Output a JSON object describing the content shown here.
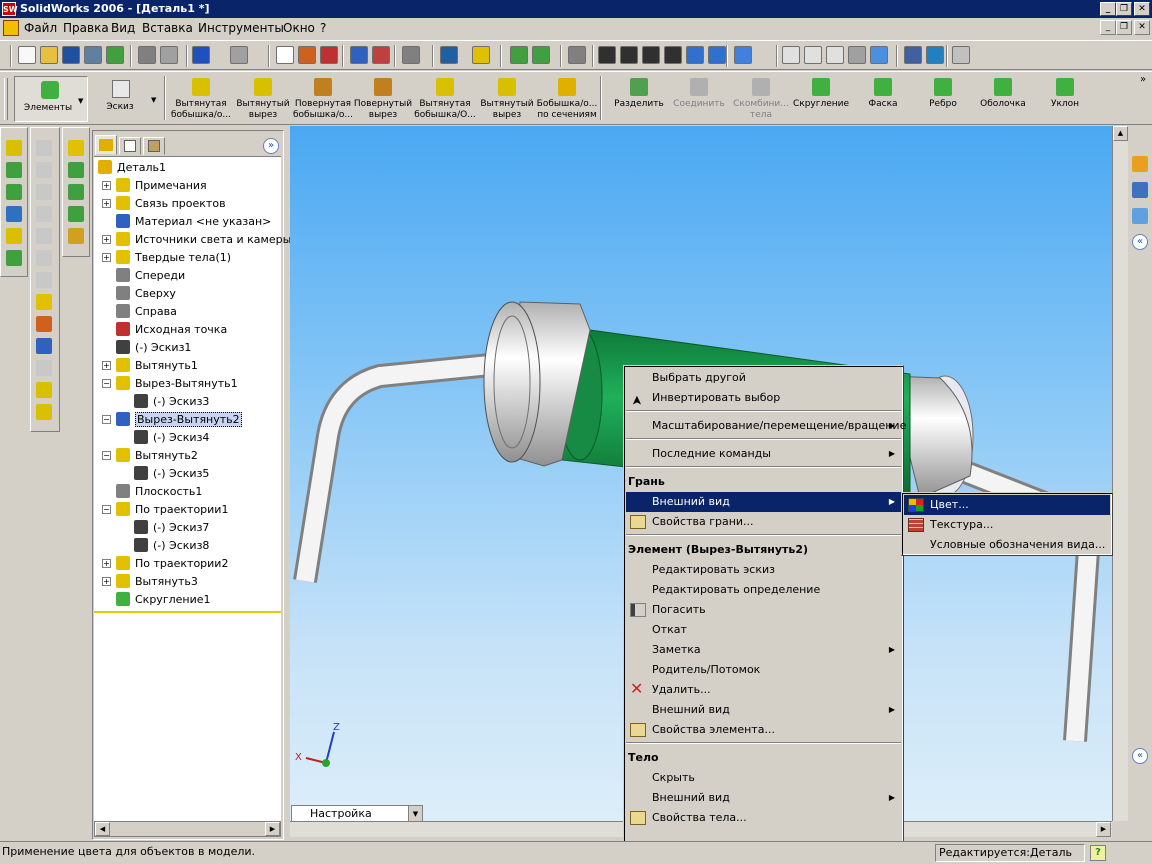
{
  "window": {
    "title": "SolidWorks 2006 - [Деталь1 *]",
    "logo_text": "SW"
  },
  "menubar": {
    "items": [
      "Файл",
      "Правка",
      "Вид",
      "Вставка",
      "Инструменты",
      "Окно",
      "?"
    ]
  },
  "features_toolbar": {
    "tabs": [
      {
        "label": "Элементы",
        "active": true
      },
      {
        "label": "Эскиз",
        "active": false
      }
    ],
    "buttons": [
      {
        "line1": "Вытянутая",
        "line2": "бобышка/о...",
        "enabled": true,
        "icon": "extrude-boss-icon",
        "color": "#d8c000"
      },
      {
        "line1": "Вытянутый",
        "line2": "вырез",
        "enabled": true,
        "icon": "extrude-cut-icon",
        "color": "#d8c000"
      },
      {
        "line1": "Повернутая",
        "line2": "бобышка/о...",
        "enabled": true,
        "icon": "revolve-boss-icon",
        "color": "#c08020"
      },
      {
        "line1": "Повернутый",
        "line2": "вырез",
        "enabled": true,
        "icon": "revolve-cut-icon",
        "color": "#c08020"
      },
      {
        "line1": "Вытянутая",
        "line2": "бобышка/О...",
        "enabled": true,
        "icon": "sweep-boss-icon",
        "color": "#d8c000"
      },
      {
        "line1": "Вытянутый",
        "line2": "вырез",
        "enabled": true,
        "icon": "sweep-cut-icon",
        "color": "#d8c000"
      },
      {
        "line1": "Бобышка/о...",
        "line2": "по сечениям",
        "enabled": true,
        "icon": "loft-icon",
        "color": "#e0b000"
      },
      {
        "line1": "Разделить",
        "line2": "",
        "enabled": true,
        "icon": "split-icon",
        "color": "#50a050"
      },
      {
        "line1": "Соединить",
        "line2": "",
        "enabled": false,
        "icon": "combine-icon",
        "color": "#b0b0b0"
      },
      {
        "line1": "Скомбини...",
        "line2": "тела",
        "enabled": false,
        "icon": "join-bodies-icon",
        "color": "#b0b0b0"
      },
      {
        "line1": "Скругление",
        "line2": "",
        "enabled": true,
        "icon": "fillet-icon",
        "color": "#40b040"
      },
      {
        "line1": "Фаска",
        "line2": "",
        "enabled": true,
        "icon": "chamfer-icon",
        "color": "#40b040"
      },
      {
        "line1": "Ребро",
        "line2": "",
        "enabled": true,
        "icon": "rib-icon",
        "color": "#40b040"
      },
      {
        "line1": "Оболочка",
        "line2": "",
        "enabled": true,
        "icon": "shell-icon",
        "color": "#40b040"
      },
      {
        "line1": "Уклон",
        "line2": "",
        "enabled": true,
        "icon": "draft-icon",
        "color": "#40b040"
      }
    ]
  },
  "feature_tree": {
    "root": "Деталь1",
    "items": [
      {
        "label": "Примечания",
        "depth": 1,
        "expander": "+",
        "icon": "annotations-icon",
        "color": "#e0c000",
        "selected": false
      },
      {
        "label": "Связь проектов",
        "depth": 1,
        "expander": "+",
        "icon": "design-binder-icon",
        "color": "#e0c000",
        "selected": false
      },
      {
        "label": "Материал <не указан>",
        "depth": 1,
        "expander": "",
        "icon": "material-icon",
        "color": "#3060c0",
        "selected": false
      },
      {
        "label": "Источники света и камеры",
        "depth": 1,
        "expander": "+",
        "icon": "lights-icon",
        "color": "#e0c000",
        "selected": false
      },
      {
        "label": "Твердые тела(1)",
        "depth": 1,
        "expander": "+",
        "icon": "solid-bodies-icon",
        "color": "#e0c000",
        "selected": false
      },
      {
        "label": "Спереди",
        "depth": 1,
        "expander": "",
        "icon": "plane-icon",
        "color": "#808080",
        "selected": false
      },
      {
        "label": "Сверху",
        "depth": 1,
        "expander": "",
        "icon": "plane-icon",
        "color": "#808080",
        "selected": false
      },
      {
        "label": "Справа",
        "depth": 1,
        "expander": "",
        "icon": "plane-icon",
        "color": "#808080",
        "selected": false
      },
      {
        "label": "Исходная точка",
        "depth": 1,
        "expander": "",
        "icon": "origin-icon",
        "color": "#c03030",
        "selected": false
      },
      {
        "label": "(-) Эскиз1",
        "depth": 1,
        "expander": "",
        "icon": "sketch-icon",
        "color": "#404040",
        "selected": false
      },
      {
        "label": "Вытянуть1",
        "depth": 1,
        "expander": "+",
        "icon": "extrude-icon",
        "color": "#e0c000",
        "selected": false
      },
      {
        "label": "Вырез-Вытянуть1",
        "depth": 1,
        "expander": "-",
        "icon": "cut-extrude-icon",
        "color": "#e0c000",
        "selected": false
      },
      {
        "label": "(-) Эскиз3",
        "depth": 2,
        "expander": "",
        "icon": "sketch-icon",
        "color": "#404040",
        "selected": false
      },
      {
        "label": "Вырез-Вытянуть2",
        "depth": 1,
        "expander": "-",
        "icon": "cut-extrude-icon",
        "color": "#3060c0",
        "selected": true
      },
      {
        "label": "(-) Эскиз4",
        "depth": 2,
        "expander": "",
        "icon": "sketch-icon",
        "color": "#404040",
        "selected": false
      },
      {
        "label": "Вытянуть2",
        "depth": 1,
        "expander": "-",
        "icon": "extrude-icon",
        "color": "#e0c000",
        "selected": false
      },
      {
        "label": "(-) Эскиз5",
        "depth": 2,
        "expander": "",
        "icon": "sketch-icon",
        "color": "#404040",
        "selected": false
      },
      {
        "label": "Плоскость1",
        "depth": 1,
        "expander": "",
        "icon": "plane-icon",
        "color": "#808080",
        "selected": false
      },
      {
        "label": "По траектории1",
        "depth": 1,
        "expander": "-",
        "icon": "sweep-icon",
        "color": "#e0c000",
        "selected": false
      },
      {
        "label": "(-) Эскиз7",
        "depth": 2,
        "expander": "",
        "icon": "sketch-icon",
        "color": "#404040",
        "selected": false
      },
      {
        "label": "(-) Эскиз8",
        "depth": 2,
        "expander": "",
        "icon": "sketch-icon",
        "color": "#404040",
        "selected": false
      },
      {
        "label": "По траектории2",
        "depth": 1,
        "expander": "+",
        "icon": "sweep-icon",
        "color": "#e0c000",
        "selected": false
      },
      {
        "label": "Вытянуть3",
        "depth": 1,
        "expander": "+",
        "icon": "extrude-icon",
        "color": "#e0c000",
        "selected": false
      },
      {
        "label": "Скругление1",
        "depth": 1,
        "expander": "",
        "icon": "fillet-icon",
        "color": "#40b040",
        "selected": false
      }
    ]
  },
  "viewport": {
    "config_dropdown": "Настройка",
    "triad": {
      "x": "X",
      "z": "Z"
    },
    "face_color": "#1a9a4a"
  },
  "context_menu": {
    "groups": [
      {
        "header": "",
        "items": [
          {
            "label": "Выбрать другой",
            "icon": "",
            "submenu": false,
            "highlight": false
          },
          {
            "label": "Инвертировать выбор",
            "icon": "cursor-icon",
            "submenu": false,
            "highlight": false
          }
        ]
      },
      {
        "header": "",
        "items": [
          {
            "label": "Масштабирование/перемещение/вращение",
            "icon": "",
            "submenu": true,
            "highlight": false
          }
        ]
      },
      {
        "header": "",
        "items": [
          {
            "label": "Последние команды",
            "icon": "",
            "submenu": true,
            "highlight": false
          }
        ]
      },
      {
        "header": "Грань",
        "items": [
          {
            "label": "Внешний вид",
            "icon": "",
            "submenu": true,
            "highlight": true
          },
          {
            "label": "Свойства грани...",
            "icon": "properties-icon",
            "submenu": false,
            "highlight": false
          }
        ]
      },
      {
        "header": "Элемент (Вырез-Вытянуть2)",
        "items": [
          {
            "label": "Редактировать эскиз",
            "icon": "",
            "submenu": false,
            "highlight": false
          },
          {
            "label": "Редактировать определение",
            "icon": "",
            "submenu": false,
            "highlight": false
          },
          {
            "label": "Погасить",
            "icon": "suppress-icon",
            "submenu": false,
            "highlight": false
          },
          {
            "label": "Откат",
            "icon": "",
            "submenu": false,
            "highlight": false
          },
          {
            "label": "Заметка",
            "icon": "",
            "submenu": true,
            "highlight": false
          },
          {
            "label": "Родитель/Потомок",
            "icon": "",
            "submenu": false,
            "highlight": false
          },
          {
            "label": "Удалить...",
            "icon": "delete-icon",
            "submenu": false,
            "highlight": false
          },
          {
            "label": "Внешний вид",
            "icon": "",
            "submenu": true,
            "highlight": false
          },
          {
            "label": "Свойства элемента...",
            "icon": "properties-icon",
            "submenu": false,
            "highlight": false
          }
        ]
      },
      {
        "header": "Тело",
        "items": [
          {
            "label": "Скрыть",
            "icon": "",
            "submenu": false,
            "highlight": false
          },
          {
            "label": "Внешний вид",
            "icon": "",
            "submenu": true,
            "highlight": false
          },
          {
            "label": "Свойства тела...",
            "icon": "properties-icon",
            "submenu": false,
            "highlight": false
          }
        ]
      }
    ],
    "more_glyph": "»"
  },
  "submenu": {
    "items": [
      {
        "label": "Цвет...",
        "icon": "color-palette-icon",
        "highlight": true
      },
      {
        "label": "Текстура...",
        "icon": "texture-icon",
        "highlight": false
      },
      {
        "label": "Условные обозначения вида...",
        "icon": "",
        "highlight": false
      }
    ]
  },
  "statusbar": {
    "message": "Применение цвета для объектов в модели.",
    "editing": "Редактируется:Деталь",
    "help": "?"
  }
}
